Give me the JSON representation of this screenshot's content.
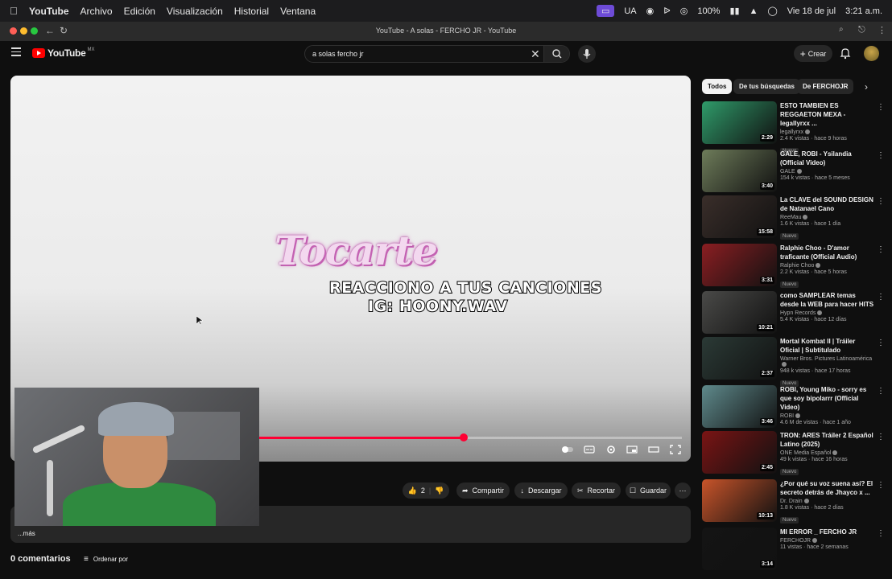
{
  "menubar": {
    "app": "YouTube",
    "items": [
      "Archivo",
      "Edición",
      "Visualización",
      "Historial",
      "Ventana"
    ],
    "right": {
      "ua": "UA",
      "battery": "100%",
      "date": "Vie 18 de jul",
      "time": "3:21 a.m."
    }
  },
  "browser": {
    "title": "YouTube - A solas - FERCHO JR - YouTube"
  },
  "header": {
    "logo_text": "YouTube",
    "country": "MX",
    "search_value": "a solas fercho jr",
    "create_label": "Crear"
  },
  "video": {
    "overlay_title": "Tocarte",
    "overlay_line1": "REACCIONO A TUS CANCIONES",
    "overlay_line2": "IG: HOONY.WAV",
    "progress": 0.67
  },
  "actions": {
    "likes": "2",
    "share": "Compartir",
    "download": "Descargar",
    "clip": "Recortar",
    "save": "Guardar"
  },
  "description": {
    "more": "...más"
  },
  "comments": {
    "count_label": "0 comentarios",
    "sort_label": "Ordenar por"
  },
  "chips": [
    {
      "label": "Todos",
      "active": true
    },
    {
      "label": "De tus búsquedas",
      "active": false
    },
    {
      "label": "De FERCHOJR",
      "active": false
    }
  ],
  "recommendations": [
    {
      "title": "ESTO TAMBIEN ES REGGAETON MEXA - legallyrxx ...",
      "channel": "legallyrxx",
      "meta": "2.4 K vistas · hace 9 horas",
      "badge": "Nuevo",
      "duration": "2:29",
      "thumb_color": "#2f9b6a"
    },
    {
      "title": "GALE, ROBI - Ysilandia (Official Video)",
      "channel": "GALE",
      "meta": "154 k vistas · hace 5 meses",
      "badge": "",
      "duration": "3:40",
      "thumb_color": "#6e7c5a"
    },
    {
      "title": "La CLAVE del SOUND DESIGN de Natanael Cano",
      "channel": "ReeMau",
      "meta": "1.6 K vistas · hace 1 día",
      "badge": "Nuevo",
      "duration": "15:58",
      "thumb_color": "#3a2e2a"
    },
    {
      "title": "Ralphie Choo - D'amor traficante (Official Audio)",
      "channel": "Ralphie Choo",
      "meta": "2.2 K vistas · hace 5 horas",
      "badge": "Nuevo",
      "duration": "3:31",
      "thumb_color": "#8b1e22"
    },
    {
      "title": "como SAMPLEAR temas desde la WEB para hacer HITS",
      "channel": "Hypn Records",
      "meta": "5.4 K vistas · hace 12 días",
      "badge": "",
      "duration": "10:21",
      "thumb_color": "#4a4a48"
    },
    {
      "title": "Mortal Kombat II | Tráiler Oficial | Subtitulado",
      "channel": "Warner Bros. Pictures Latinoamérica",
      "meta": "948 k vistas · hace 17 horas",
      "badge": "Nuevo",
      "duration": "2:37",
      "thumb_color": "#2b3a36"
    },
    {
      "title": "ROBI, Young Miko - sorry es que soy bipolarrr (Official Video)",
      "channel": "ROBI",
      "meta": "4.6 M de vistas · hace 1 año",
      "badge": "",
      "duration": "3:46",
      "thumb_color": "#5f8a8c"
    },
    {
      "title": "TRON: ARES Tráiler 2 Español Latino (2025)",
      "channel": "ONE Media Español",
      "meta": "49 k vistas · hace 16 horas",
      "badge": "Nuevo",
      "duration": "2:45",
      "thumb_color": "#7a1414"
    },
    {
      "title": "¿Por qué su voz suena así? El secreto detrás de Jhayco x ...",
      "channel": "Dr. Drain",
      "meta": "1.8 K vistas · hace 2 días",
      "badge": "Nuevo",
      "duration": "10:13",
      "thumb_color": "#c8542a"
    },
    {
      "title": "MI ERROR _ FERCHO JR",
      "channel": "FERCHOJR",
      "meta": "11 vistas · hace 2 semanas",
      "badge": "",
      "duration": "3:14",
      "thumb_color": "#141414"
    }
  ]
}
